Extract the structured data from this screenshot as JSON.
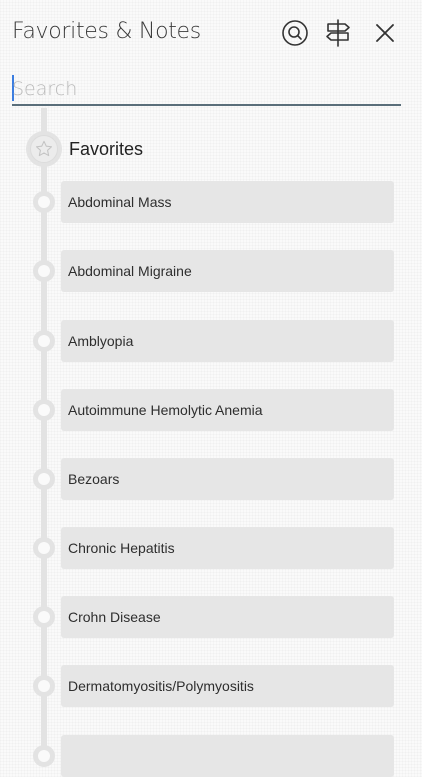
{
  "header": {
    "title": "Favorites & Notes",
    "icons": [
      "search-icon",
      "signpost-icon",
      "close-icon"
    ]
  },
  "search": {
    "placeholder": "Search",
    "value": ""
  },
  "favorites": {
    "title": "Favorites",
    "badge_icon": "star-icon",
    "items": [
      {
        "label": "Abdominal Mass"
      },
      {
        "label": "Abdominal Migraine"
      },
      {
        "label": "Amblyopia"
      },
      {
        "label": "Autoimmune Hemolytic Anemia"
      },
      {
        "label": "Bezoars"
      },
      {
        "label": "Chronic Hepatitis"
      },
      {
        "label": "Crohn Disease"
      },
      {
        "label": "Dermatomyositis/Polymyositis"
      }
    ]
  },
  "colors": {
    "background": "#fafafa",
    "rail": "#e3e3e3",
    "card": "#e6e6e6",
    "search_underline": "#5a6e7a",
    "caret": "#3b7de0",
    "text": "#2b2b2b"
  }
}
